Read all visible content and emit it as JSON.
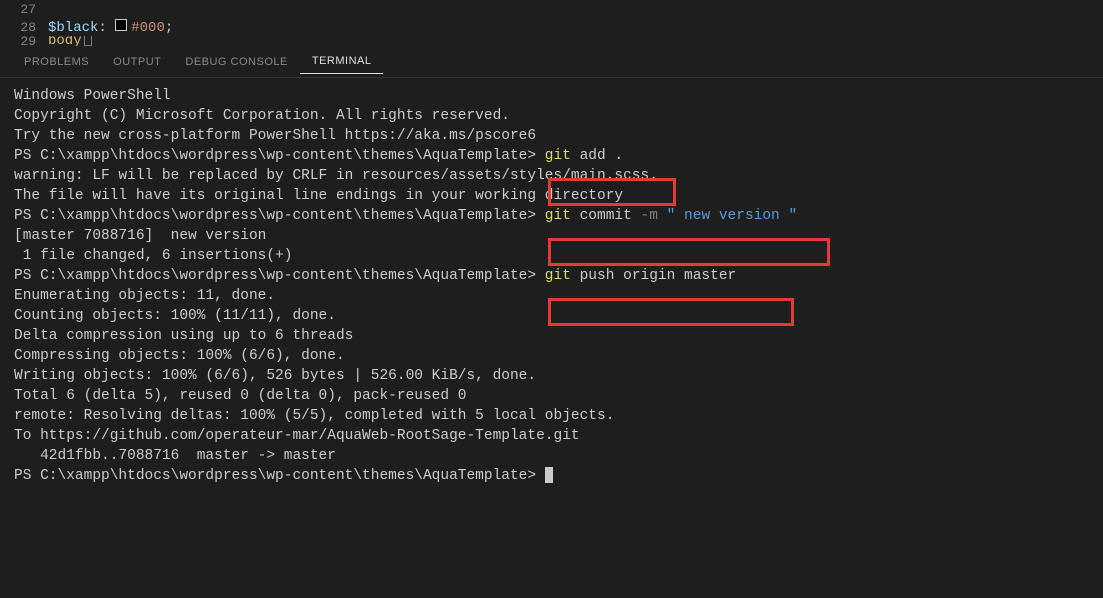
{
  "editor": {
    "lines": [
      {
        "num": "27",
        "content": ""
      },
      {
        "num": "28",
        "content_var": "$black",
        "colon": ":",
        "hex": "#000",
        "semi": ";"
      },
      {
        "num": "29",
        "content_kw": "body"
      }
    ]
  },
  "panelTabs": {
    "problems": "PROBLEMS",
    "output": "OUTPUT",
    "debug": "DEBUG CONSOLE",
    "terminal": "TERMINAL"
  },
  "terminal": {
    "l1": "Windows PowerShell",
    "l2": "Copyright (C) Microsoft Corporation. All rights reserved.",
    "blank1": "",
    "l3": "Try the new cross-platform PowerShell https://aka.ms/pscore6",
    "blank2": "",
    "p1_path": "PS C:\\xampp\\htdocs\\wordpress\\wp-content\\themes\\AquaTemplate> ",
    "p1_git": "git ",
    "p1_cmd": "add .",
    "l5": "warning: LF will be replaced by CRLF in resources/assets/styles/main.scss.",
    "l6": "The file will have its original line endings in your working directory",
    "p2_path": "PS C:\\xampp\\htdocs\\wordpress\\wp-content\\themes\\AquaTemplate> ",
    "p2_git": "git ",
    "p2_cmd": "commit ",
    "p2_flag": "-m ",
    "p2_str": "\" new version \"",
    "l8": "[master 7088716]  new version",
    "l9": " 1 file changed, 6 insertions(+)",
    "p3_path": "PS C:\\xampp\\htdocs\\wordpress\\wp-content\\themes\\AquaTemplate> ",
    "p3_git": "git ",
    "p3_cmd": "push origin master",
    "l11": "Enumerating objects: 11, done.",
    "l12": "Counting objects: 100% (11/11), done.",
    "l13": "Delta compression using up to 6 threads",
    "l14": "Compressing objects: 100% (6/6), done.",
    "l15": "Writing objects: 100% (6/6), 526 bytes | 526.00 KiB/s, done.",
    "l16": "Total 6 (delta 5), reused 0 (delta 0), pack-reused 0",
    "l17": "remote: Resolving deltas: 100% (5/5), completed with 5 local objects.",
    "l18": "To https://github.com/operateur-mar/AquaWeb-RootSage-Template.git",
    "l19": "   42d1fbb..7088716  master -> master",
    "p4_path": "PS C:\\xampp\\htdocs\\wordpress\\wp-content\\themes\\AquaTemplate> "
  }
}
